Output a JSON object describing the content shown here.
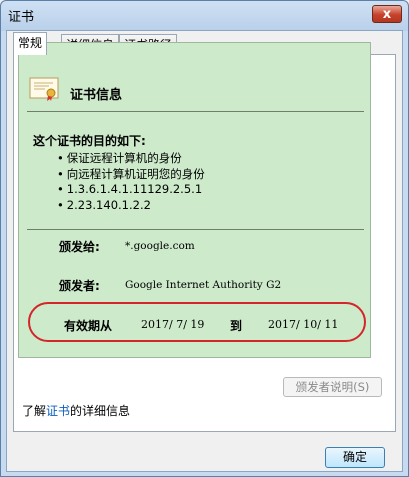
{
  "window": {
    "title": "证书",
    "close_glyph": "x"
  },
  "tabs": [
    {
      "label": "常规",
      "active": true
    },
    {
      "label": "详细信息",
      "active": false
    },
    {
      "label": "证书路径",
      "active": false
    }
  ],
  "certificate": {
    "icon": "certificate-icon",
    "heading": "证书信息",
    "purpose_heading": "这个证书的目的如下:",
    "purposes": [
      "保证远程计算机的身份",
      "向远程计算机证明您的身份",
      "1.3.6.1.4.1.11129.2.5.1",
      "2.23.140.1.2.2"
    ],
    "issued_to_label": "颁发给:",
    "issued_to_value": "*.google.com",
    "issued_by_label": "颁发者:",
    "issued_by_value": "Google Internet Authority G2",
    "valid_from_label": "有效期从",
    "valid_from_value": "2017/  7/  19",
    "valid_to_label": "到",
    "valid_to_value": "2017/  10/  11"
  },
  "buttons": {
    "issuer_statement": "颁发者说明(S)",
    "ok": "确定"
  },
  "learn_more": {
    "prefix": "了解",
    "link": "证书",
    "suffix": "的详细信息"
  },
  "colors": {
    "info_background": "#cdeacb",
    "highlight_ellipse": "#d3252a",
    "link": "#0b5fbf"
  }
}
